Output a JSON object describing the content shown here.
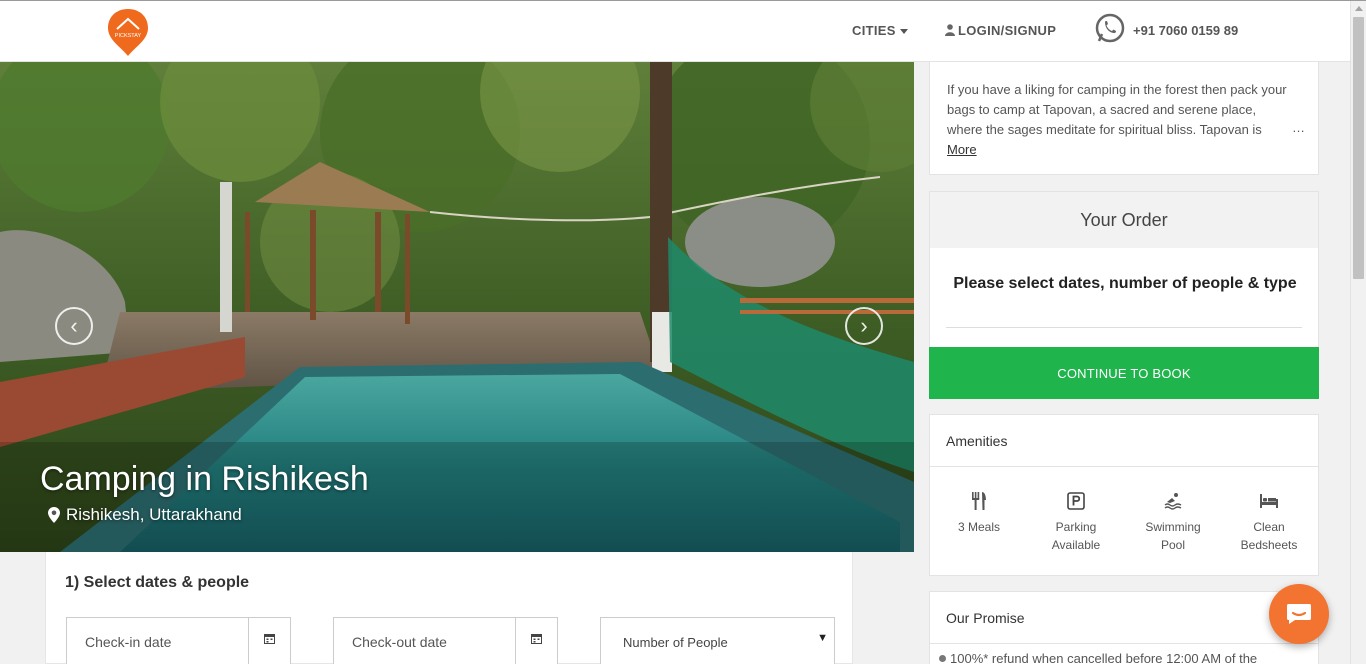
{
  "header": {
    "logo_text": "PICKSTAY",
    "cities_label": "CITIES",
    "login_label": "LOGIN/SIGNUP",
    "phone": "+91 7060 0159 89"
  },
  "hero": {
    "title": "Camping in Rishikesh",
    "location": "Rishikesh, Uttarakhand",
    "prev_label": "‹",
    "next_label": "›"
  },
  "booking": {
    "section_title": "1) Select dates & people",
    "checkin_placeholder": "Check-in date",
    "checkout_placeholder": "Check-out date",
    "people_select": "Number of People",
    "people_caret": "▼"
  },
  "description": {
    "text": "If you have a liking for camping in the forest then pack your bags to camp at Tapovan, a sacred and serene place, where the sages meditate for spiritual bliss. Tapovan is",
    "ellipsis": "…",
    "more_label": "More"
  },
  "order": {
    "heading": "Your Order",
    "message": "Please select dates, number of people & type",
    "continue_label": "CONTINUE TO BOOK"
  },
  "amenities": {
    "heading": "Amenities",
    "items": [
      {
        "label": "3 Meals",
        "icon": "meals-icon"
      },
      {
        "label": "Parking Available",
        "icon": "parking-icon"
      },
      {
        "label": "Swimming Pool",
        "icon": "swimming-pool-icon"
      },
      {
        "label": "Clean Bedsheets",
        "icon": "bed-icon"
      }
    ]
  },
  "promise": {
    "heading": "Our Promise",
    "text": "100%* refund when cancelled before 12:00 AM of the"
  },
  "colors": {
    "brand_orange": "#f06a1e",
    "continue_green": "#1fb44c",
    "chat_orange": "#f27430"
  }
}
